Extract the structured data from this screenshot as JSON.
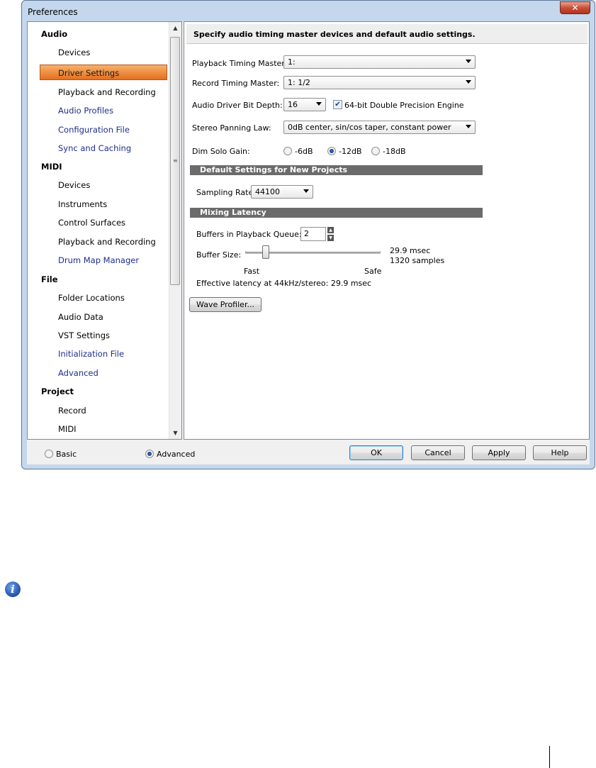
{
  "window": {
    "title": "Preferences",
    "close_glyph": "✕"
  },
  "tree": {
    "categories": [
      {
        "label": "Audio",
        "items": [
          {
            "label": "Devices"
          },
          {
            "label": "Driver Settings",
            "selected": true
          },
          {
            "label": "Playback and Recording"
          },
          {
            "label": "Audio Profiles",
            "link": true
          },
          {
            "label": "Configuration File",
            "link": true
          },
          {
            "label": "Sync and Caching",
            "link": true
          }
        ]
      },
      {
        "label": "MIDI",
        "items": [
          {
            "label": "Devices"
          },
          {
            "label": "Instruments"
          },
          {
            "label": "Control Surfaces"
          },
          {
            "label": "Playback and Recording"
          },
          {
            "label": "Drum Map Manager",
            "link": true
          }
        ]
      },
      {
        "label": "File",
        "items": [
          {
            "label": "Folder Locations"
          },
          {
            "label": "Audio Data"
          },
          {
            "label": "VST Settings"
          },
          {
            "label": "Initialization File",
            "link": true
          },
          {
            "label": "Advanced",
            "link": true
          }
        ]
      },
      {
        "label": "Project",
        "items": [
          {
            "label": "Record"
          },
          {
            "label": "MIDI"
          }
        ]
      }
    ],
    "scroll_up": "▲",
    "scroll_down": "▼",
    "grip": "≡"
  },
  "panel": {
    "header": "Specify audio timing master devices and default audio settings.",
    "playback_timing_label": "Playback Timing Master:",
    "playback_timing_value": "1:",
    "record_timing_label": "Record Timing Master:",
    "record_timing_value": "1:  1/2",
    "bit_depth_label": "Audio Driver Bit Depth:",
    "bit_depth_value": "16",
    "double_precision_label": "64-bit Double Precision Engine",
    "double_precision_checked": true,
    "panning_label": "Stereo Panning Law:",
    "panning_value": "0dB center, sin/cos taper, constant power",
    "dim_solo_label": "Dim Solo Gain:",
    "dim_solo_options": [
      "-6dB",
      "-12dB",
      "-18dB"
    ],
    "dim_solo_selected": "-12dB",
    "defaults_section": "Default Settings for New Projects",
    "sampling_rate_label": "Sampling Rate:",
    "sampling_rate_value": "44100",
    "latency_section": "Mixing Latency",
    "buffers_label": "Buffers in Playback Queue:",
    "buffers_value": "2",
    "buffer_size_label": "Buffer Size:",
    "buffer_msec": "29.9 msec",
    "buffer_samples": "1320 samples",
    "slider_fast": "Fast",
    "slider_safe": "Safe",
    "effective_latency": "Effective latency at 44kHz/stereo:  29.9 msec",
    "wave_profiler_button": "Wave Profiler..."
  },
  "footer": {
    "mode_basic": "Basic",
    "mode_advanced": "Advanced",
    "mode_selected": "Advanced",
    "ok": "OK",
    "cancel": "Cancel",
    "apply": "Apply",
    "help": "Help"
  },
  "info_icon_glyph": "i"
}
